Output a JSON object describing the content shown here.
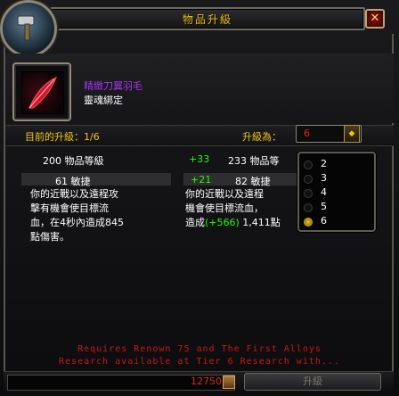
{
  "window": {
    "title": "物品升級",
    "close_icon": "close-icon"
  },
  "item": {
    "name": "精緻刀翼羽毛",
    "name_color": "#a335ee",
    "binding": "靈魂綁定",
    "icon": "feather-icon"
  },
  "upgrade": {
    "current_label": "目前的升級：1/6",
    "target_label": "升級為：",
    "target_value": "6"
  },
  "current": {
    "item_level": "200 物品等級",
    "stat": "61 敏捷",
    "desc_lines": [
      "你的近戰以及遠程攻",
      "擊有機會使目標流",
      "血，在4秒內造成845",
      "點傷害。"
    ]
  },
  "upgraded": {
    "ilvl_delta": "+33",
    "item_level": "233 物品等",
    "stat_delta": "+21",
    "stat": "82 敏捷",
    "desc_line1": "你的近戰以及遠程",
    "desc_line2": "機會使目標流血，",
    "desc_line3_prefix": "造成",
    "desc_line3_delta": "(+566)",
    "desc_line3_suffix": " 1,411點"
  },
  "dropdown_menu": {
    "options": [
      "2",
      "3",
      "4",
      "5",
      "6"
    ],
    "selected": "6"
  },
  "requirement": {
    "line1": "Requires Renown 75 and The First Alloys",
    "line2": "Research available at Tier 6 Research with..."
  },
  "footer": {
    "currency_value": "12750",
    "upgrade_button": "升級"
  },
  "colors": {
    "gold": "#f0c419",
    "red": "#e0281c",
    "green": "#1eff00"
  }
}
